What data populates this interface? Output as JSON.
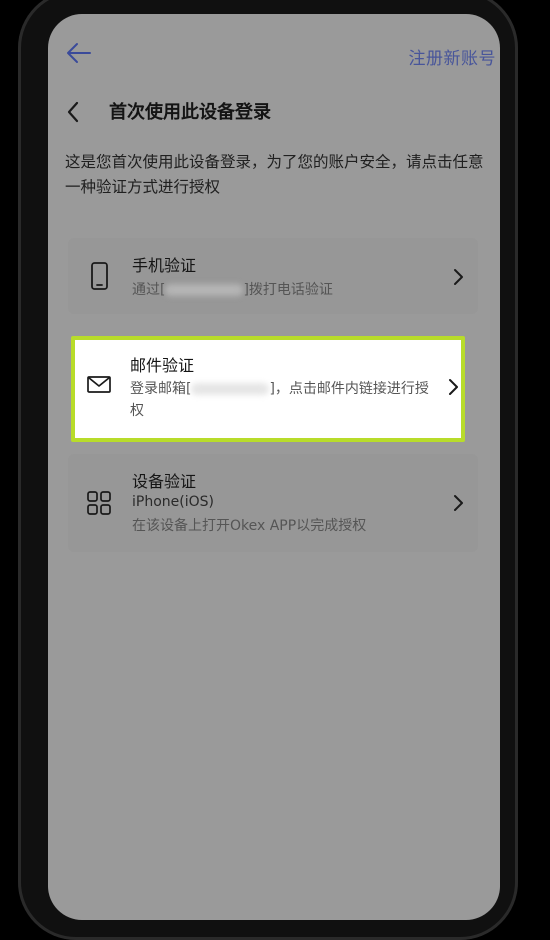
{
  "background_app": {
    "register_link": "注册新账号"
  },
  "header": {
    "title": "首次使用此设备登录"
  },
  "intro_text": "这是您首次使用此设备登录，为了您的账户安全，请点击任意一种验证方式进行授权",
  "options": {
    "phone": {
      "title": "手机验证",
      "sub_prefix": "通过[",
      "sub_suffix": "]拨打电话验证",
      "icon": "phone-icon"
    },
    "email": {
      "title": "邮件验证",
      "sub_prefix": "登录邮箱[",
      "sub_suffix": "]，点击邮件内链接进行授权",
      "icon": "mail-icon"
    },
    "device": {
      "title": "设备验证",
      "device_name": "iPhone(iOS)",
      "sub": "在该设备上打开Okex APP以完成授权",
      "icon": "grid-icon"
    }
  },
  "colors": {
    "overlay": "#9a9a9a",
    "highlight_border": "#b8dc2a",
    "register_link": "#3a4a9a"
  }
}
